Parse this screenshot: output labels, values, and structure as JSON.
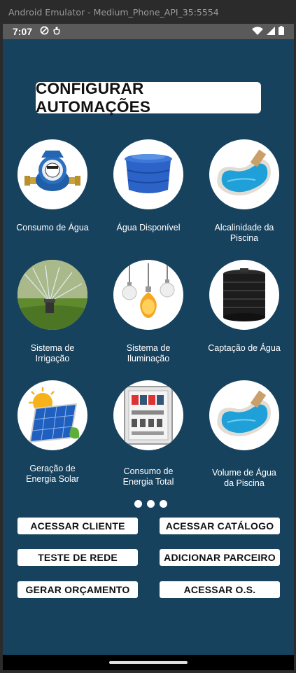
{
  "window": {
    "title": "Android Emulator - Medium_Phone_API_35:5554"
  },
  "status_bar": {
    "time": "7:07"
  },
  "page": {
    "title": "CONFIGURAR AUTOMAÇÕES"
  },
  "tiles": [
    {
      "label_line1": "Consumo de Água",
      "label_line2": "",
      "icon": "water-meter-icon"
    },
    {
      "label_line1": "Água Disponível",
      "label_line2": "",
      "icon": "water-tank-icon"
    },
    {
      "label_line1": "Alcalinidade da",
      "label_line2": "Piscina",
      "icon": "pool-icon"
    },
    {
      "label_line1": "Sistema de",
      "label_line2": "Irrigação",
      "icon": "sprinkler-icon"
    },
    {
      "label_line1": "Sistema de",
      "label_line2": "Iluminação",
      "icon": "light-bulbs-icon"
    },
    {
      "label_line1": "Captação de Água",
      "label_line2": "",
      "icon": "water-tank-black-icon"
    },
    {
      "label_line1": "Geração de",
      "label_line2": "Energia Solar",
      "icon": "solar-panel-icon"
    },
    {
      "label_line1": "Consumo de",
      "label_line2": "Energia Total",
      "icon": "electrical-panel-icon"
    },
    {
      "label_line1": "Volume de Água",
      "label_line2": "da Piscina",
      "icon": "pool-icon"
    }
  ],
  "buttons": {
    "acessar_cliente": "ACESSAR CLIENTE",
    "acessar_catalogo": "ACESSAR CATÁLOGO",
    "teste_rede": "TESTE DE REDE",
    "adicionar_parceiro": "ADICIONAR PARCEIRO",
    "gerar_orcamento": "GERAR ORÇAMENTO",
    "acessar_os": "ACESSAR O.S."
  },
  "colors": {
    "background": "#17425e",
    "button": "#ffffff"
  }
}
